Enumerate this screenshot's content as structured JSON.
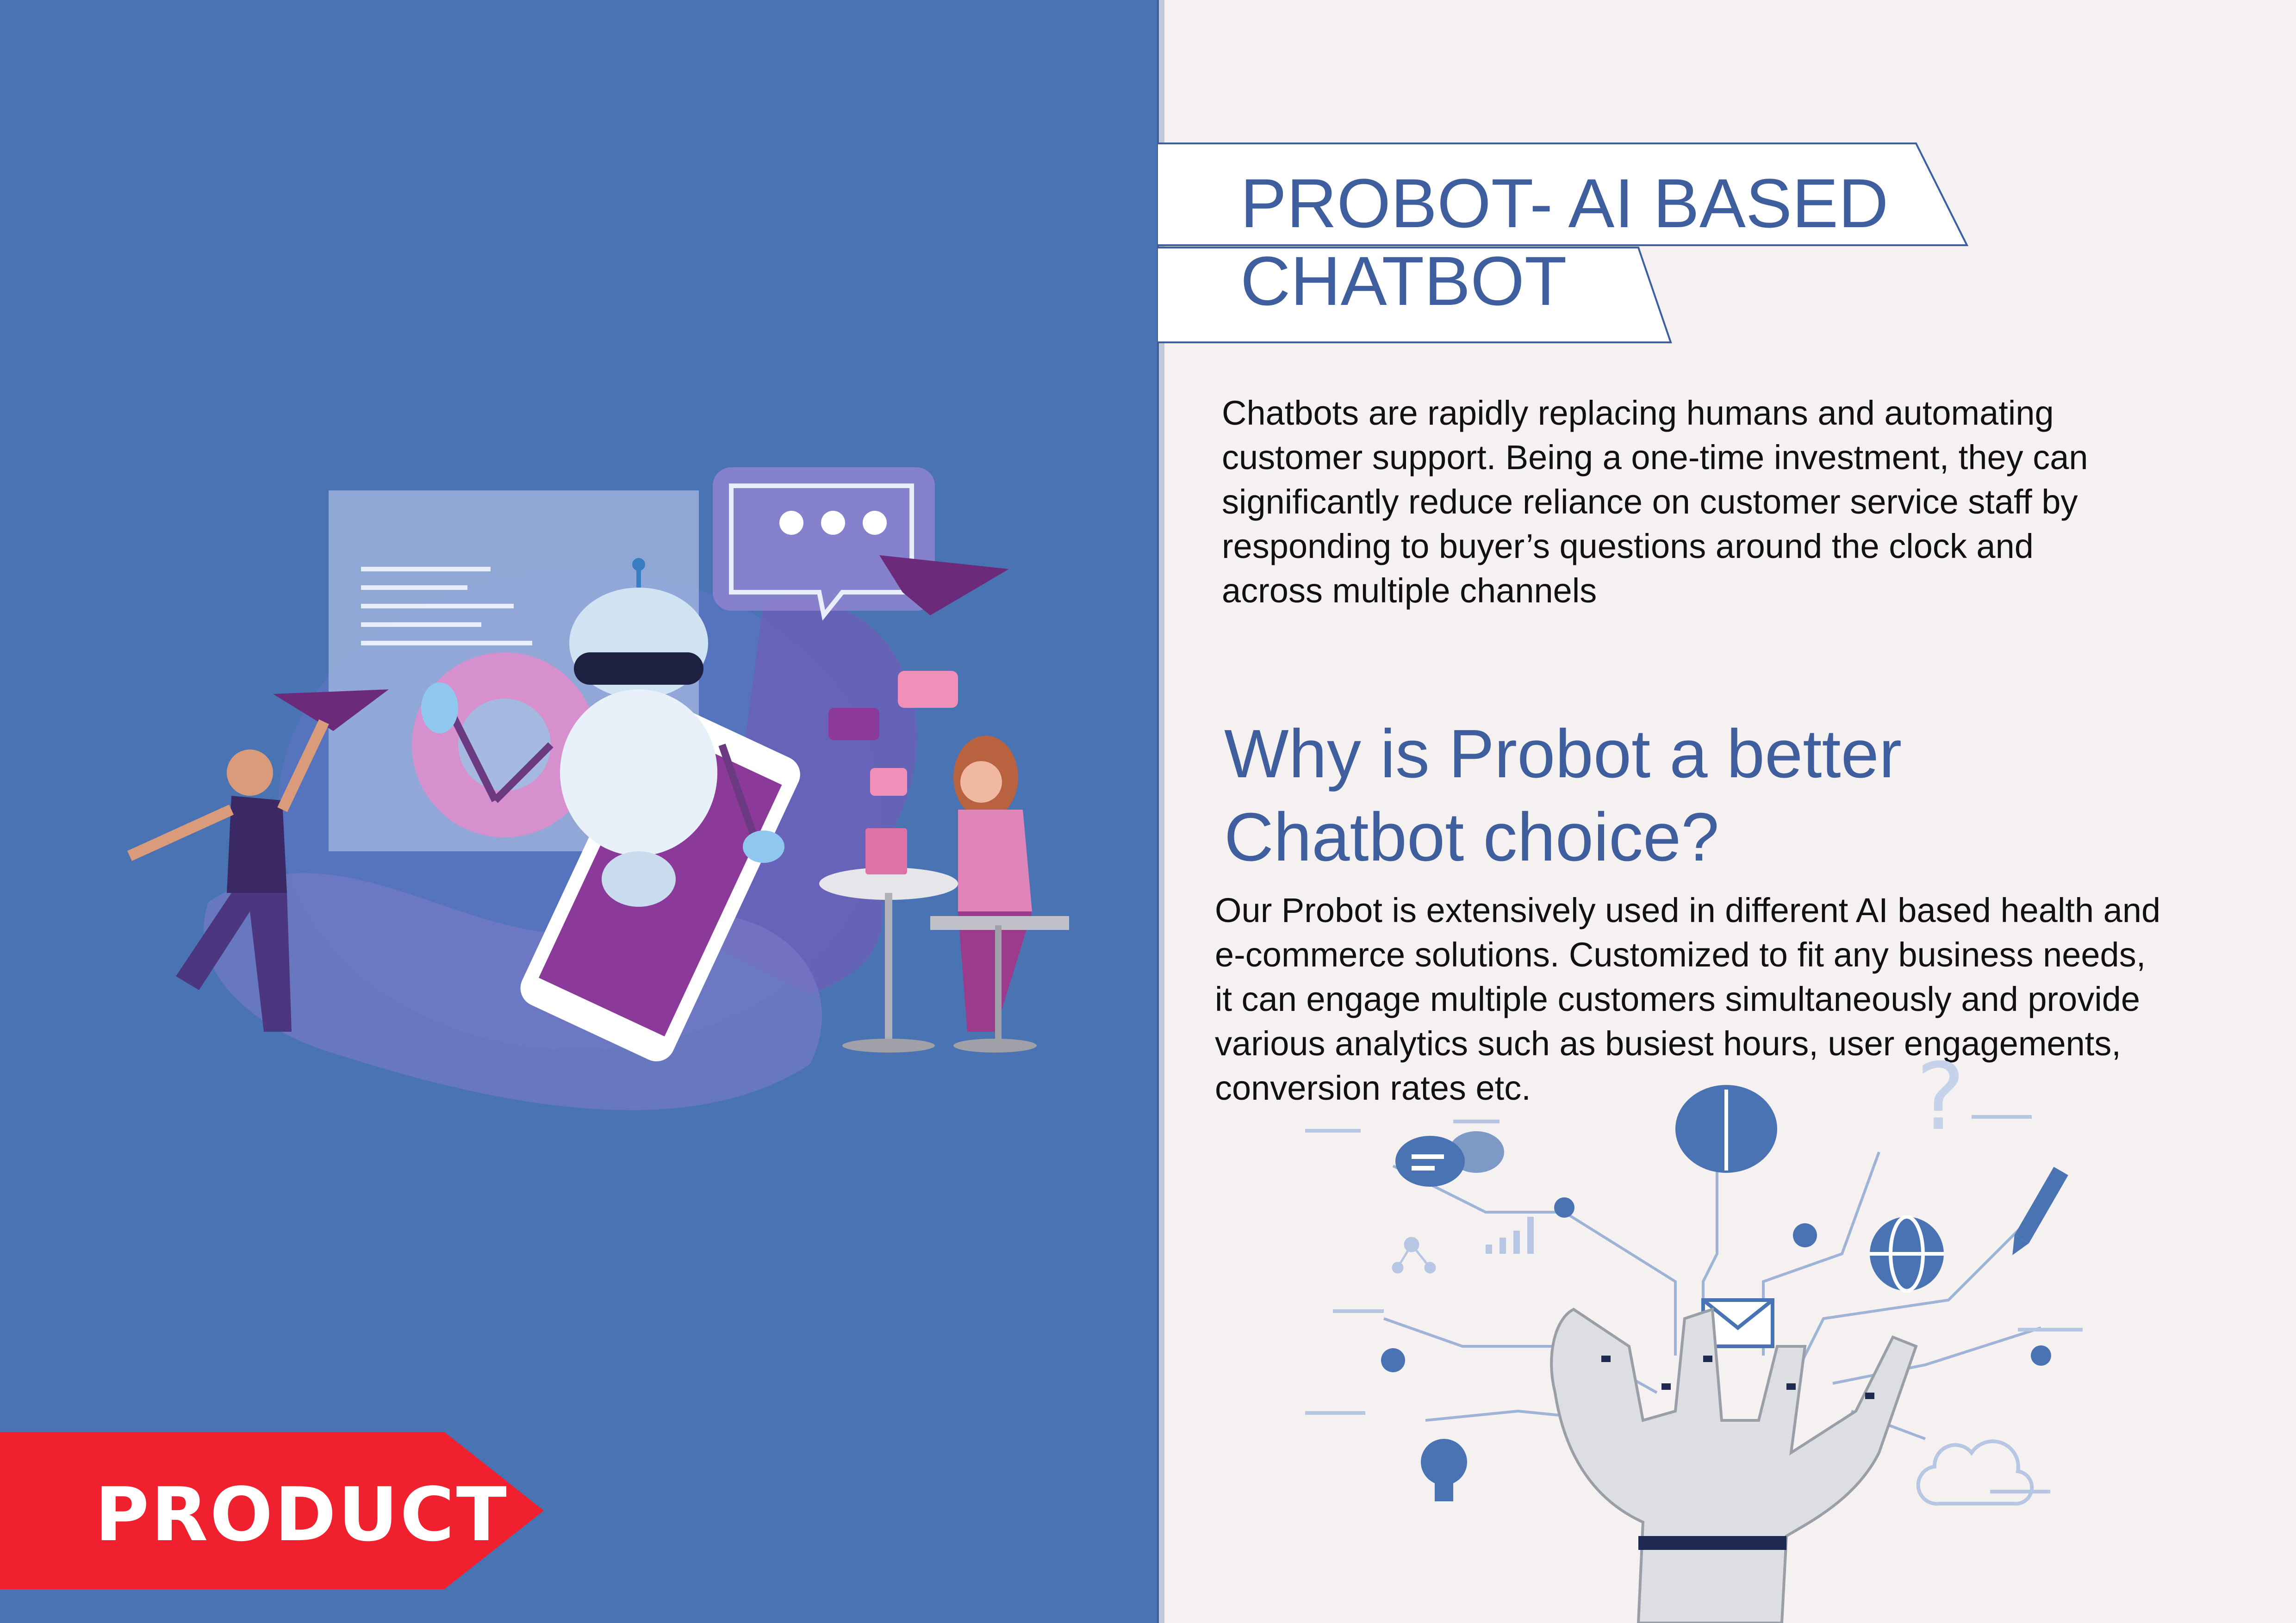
{
  "colors": {
    "left_bg": "#4a73b4",
    "right_bg": "#f6f1f1",
    "accent_blue": "#3f5e9e",
    "tag_red": "#f0202e"
  },
  "product_tag": {
    "label": "PRODUCT"
  },
  "header": {
    "title_line1": "PROBOT- AI BASED",
    "title_line2": "CHATBOT"
  },
  "intro": {
    "lines": [
      "Chatbots are rapidly replacing humans and automating",
      "customer support. Being a one-time investment, they can",
      "significantly reduce reliance on customer service staff by",
      "responding to buyer’s questions around the clock and",
      "across multiple channels"
    ]
  },
  "why": {
    "heading_line1": "Why is Probot a better",
    "heading_line2": "Chatbot choice?",
    "lines": [
      "Our Probot is extensively used in different AI based health and",
      "e-commerce solutions. Customized to fit any business needs,",
      "it can engage multiple customers simultaneously and provide",
      "various analytics such as busiest hours, user engagements,",
      "conversion rates etc."
    ]
  },
  "icons": [
    "robot-illustration-icon",
    "paper-plane-icon",
    "chat-bubble-icon",
    "gear-icon",
    "brain-icon",
    "question-mark-icon",
    "globe-icon",
    "pencil-icon",
    "envelope-icon",
    "lightbulb-icon",
    "cloud-icon",
    "robot-hand-icon"
  ]
}
